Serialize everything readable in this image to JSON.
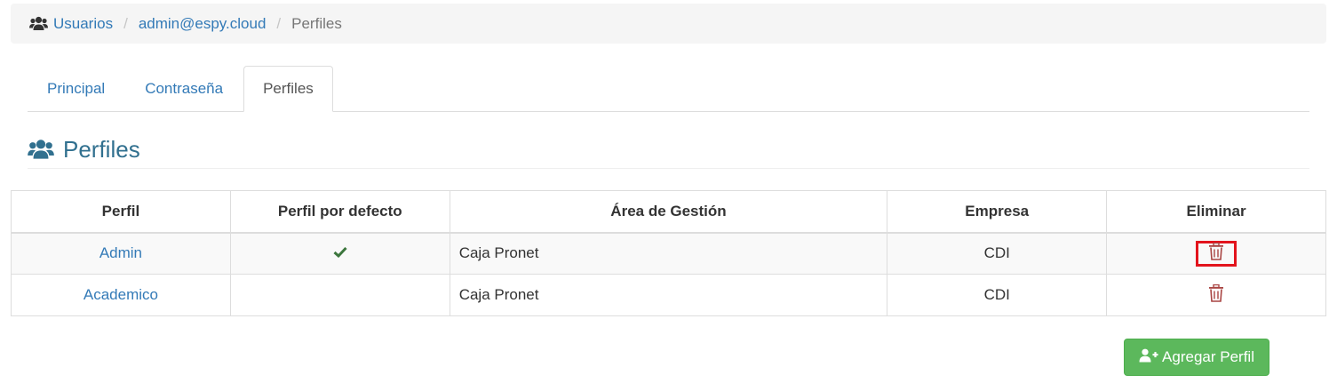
{
  "breadcrumb": {
    "icon": "users-icon",
    "items": [
      "Usuarios",
      "admin@espy.cloud",
      "Perfiles"
    ],
    "separator": "/"
  },
  "tabs": [
    {
      "label": "Principal",
      "active": false
    },
    {
      "label": "Contraseña",
      "active": false
    },
    {
      "label": "Perfiles",
      "active": true
    }
  ],
  "section": {
    "icon": "users-icon",
    "title": "Perfiles"
  },
  "table": {
    "columns": [
      "Perfil",
      "Perfil por defecto",
      "Área de Gestión",
      "Empresa",
      "Eliminar"
    ],
    "rows": [
      {
        "perfil": "Admin",
        "default": true,
        "area": "Caja Pronet",
        "empresa": "CDI",
        "delete_icon": "trash-icon",
        "highlighted": true
      },
      {
        "perfil": "Academico",
        "default": false,
        "area": "Caja Pronet",
        "empresa": "CDI",
        "delete_icon": "trash-icon",
        "highlighted": false
      }
    ]
  },
  "add_button": {
    "icon": "user-plus-icon",
    "label": "Agregar Perfil"
  },
  "colors": {
    "link": "#337ab7",
    "success": "#5cb85c",
    "danger": "#a94442",
    "highlight": "#e3141d",
    "check": "#3c763d"
  }
}
